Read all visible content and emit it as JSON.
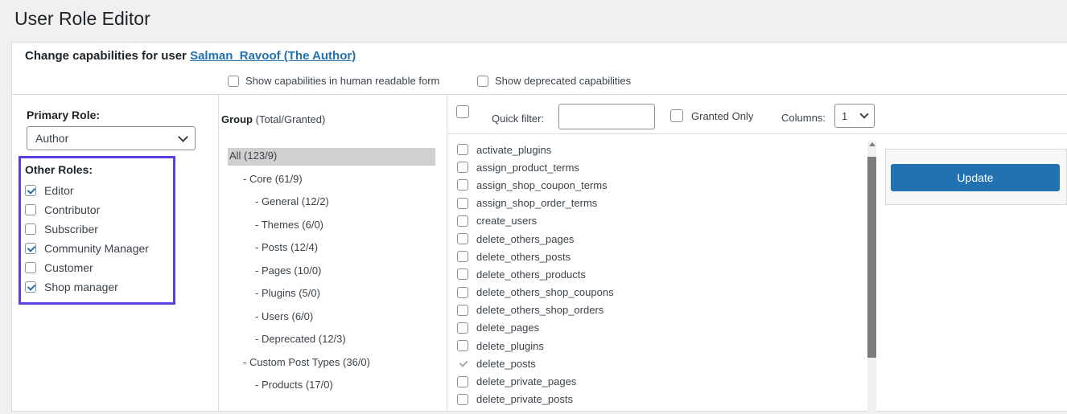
{
  "header": {
    "title": "User Role Editor"
  },
  "user_line": {
    "prefix": "Change capabilities for user",
    "user_link": "Salman_Ravoof (The Author)"
  },
  "options": [
    {
      "label": "Show capabilities in human readable form",
      "checked": false
    },
    {
      "label": "Show deprecated capabilities",
      "checked": false
    }
  ],
  "primary_role": {
    "label": "Primary Role:",
    "value": "Author"
  },
  "other_roles": {
    "label": "Other Roles:",
    "items": [
      {
        "label": "Editor",
        "checked": true
      },
      {
        "label": "Contributor",
        "checked": false
      },
      {
        "label": "Subscriber",
        "checked": false
      },
      {
        "label": "Community Manager",
        "checked": true
      },
      {
        "label": "Customer",
        "checked": false
      },
      {
        "label": "Shop manager",
        "checked": true
      }
    ]
  },
  "groups": {
    "header_bold": "Group",
    "header_rest": " (Total/Granted)",
    "items": [
      "All (123/9)",
      "- Core (61/9)",
      "- General (12/2)",
      "- Themes (6/0)",
      "- Posts (12/4)",
      "- Pages (10/0)",
      "- Plugins (5/0)",
      "- Users (6/0)",
      "- Deprecated (12/3)",
      "- Custom Post Types (36/0)",
      "- Products (17/0)"
    ]
  },
  "filter": {
    "quick_filter_label": "Quick filter:",
    "quick_filter_value": "",
    "granted_only_label": "Granted Only",
    "columns_label": "Columns:",
    "columns_value": "1"
  },
  "capabilities": [
    {
      "name": "activate_plugins",
      "checked": false
    },
    {
      "name": "assign_product_terms",
      "checked": false
    },
    {
      "name": "assign_shop_coupon_terms",
      "checked": false
    },
    {
      "name": "assign_shop_order_terms",
      "checked": false
    },
    {
      "name": "create_users",
      "checked": false
    },
    {
      "name": "delete_others_pages",
      "checked": false
    },
    {
      "name": "delete_others_posts",
      "checked": false
    },
    {
      "name": "delete_others_products",
      "checked": false
    },
    {
      "name": "delete_others_shop_coupons",
      "checked": false
    },
    {
      "name": "delete_others_shop_orders",
      "checked": false
    },
    {
      "name": "delete_pages",
      "checked": false
    },
    {
      "name": "delete_plugins",
      "checked": false
    },
    {
      "name": "delete_posts",
      "checked": true
    },
    {
      "name": "delete_private_pages",
      "checked": false
    },
    {
      "name": "delete_private_posts",
      "checked": false
    }
  ],
  "actions": {
    "update_label": "Update"
  },
  "colors": {
    "accent": "#2271b1",
    "highlight_border": "#5b3fe0",
    "selected_group": "#d0d0d0"
  }
}
